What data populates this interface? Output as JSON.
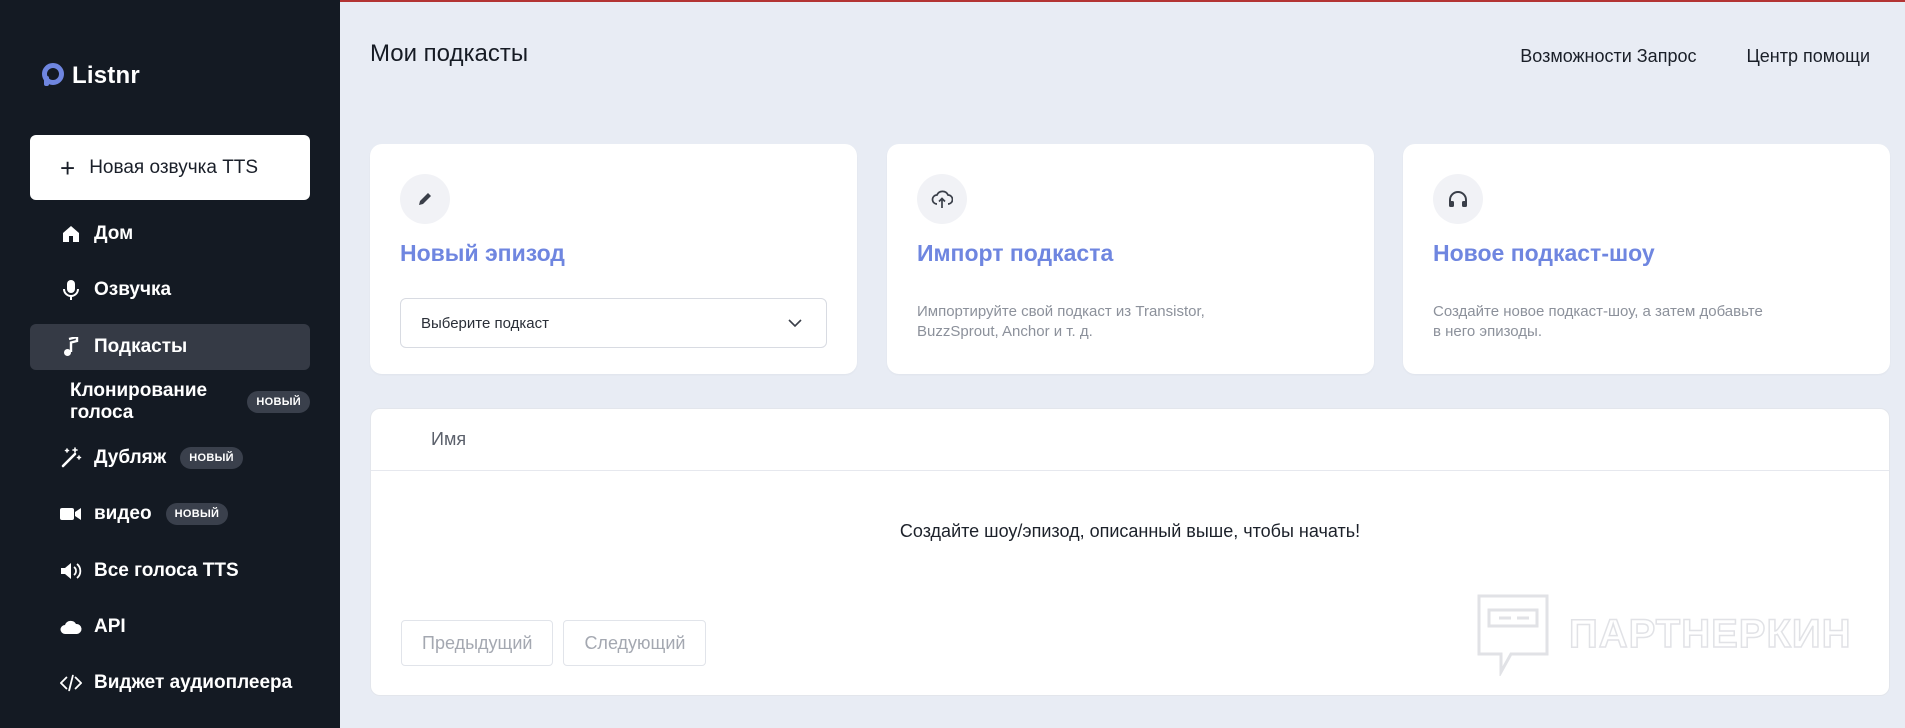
{
  "app": {
    "logo_text": "Listnr"
  },
  "sidebar": {
    "new_tts_label": "Новая озвучка TTS",
    "items": [
      {
        "label": "Дом",
        "icon": "home-icon"
      },
      {
        "label": "Озвучка",
        "icon": "microphone-icon"
      },
      {
        "label": "Подкасты",
        "icon": "music-note-icon",
        "active": true
      },
      {
        "label": "Клонирование голоса",
        "badge": "НОВЫЙ"
      },
      {
        "label": "Дубляж",
        "icon": "magic-wand-icon",
        "badge": "НОВЫЙ"
      },
      {
        "label": "видео",
        "icon": "video-camera-icon",
        "badge": "НОВЫЙ"
      },
      {
        "label": "Все голоса TTS",
        "icon": "speaker-icon"
      },
      {
        "label": "API",
        "icon": "cloud-icon"
      },
      {
        "label": "Виджет аудиоплеера",
        "icon": "code-icon"
      }
    ]
  },
  "header": {
    "title": "Мои подкасты",
    "links": [
      "Возможности Запрос",
      "Центр помощи"
    ]
  },
  "cards": [
    {
      "title": "Новый эпизод",
      "icon": "pencil-icon",
      "select_placeholder": "Выберите подкаст"
    },
    {
      "title": "Импорт подкаста",
      "icon": "cloud-upload-icon",
      "description": "Импортируйте свой подкаст из Transistor, BuzzSprout, Anchor и т. д."
    },
    {
      "title": "Новое подкаст-шоу",
      "icon": "headphones-icon",
      "description": "Создайте новое подкаст-шоу, а затем добавьте в него эпизоды."
    }
  ],
  "table": {
    "columns": [
      "Имя"
    ],
    "empty_message": "Создайте шоу/эпизод, описанный выше, чтобы начать!",
    "prev_label": "Предыдущий",
    "next_label": "Следующий"
  },
  "watermark": {
    "text": "ПАРТНЕРКИН"
  },
  "colors": {
    "sidebar_bg": "#141a23",
    "accent": "#6f86e0",
    "page_bg": "#e8ecf4"
  }
}
